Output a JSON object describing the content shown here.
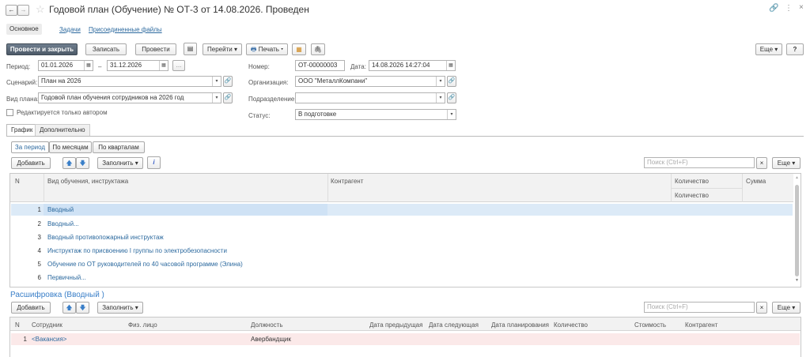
{
  "window": {
    "title": "Годовой план (Обучение) № ОТ-3 от 14.08.2026. Проведен",
    "more": "⋮",
    "close": "×"
  },
  "tabs": {
    "main": "Основное",
    "tasks": "Задачи",
    "files": "Присоединенные файлы"
  },
  "toolbar": {
    "post_close": "Провести и закрыть",
    "save": "Записать",
    "post": "Провести",
    "goto": "Перейти",
    "print": "Печать",
    "more": "Еще",
    "help": "?"
  },
  "form": {
    "period_label": "Период:",
    "period_from": "01.01.2026",
    "period_to": "31.12.2026",
    "dash": "–",
    "dots": "...",
    "scenario_label": "Сценарий:",
    "scenario": "План на 2026",
    "plan_type_label": "Вид плана:",
    "plan_type": "Годовой план обучения сотрудников на 2026 год",
    "author_only_label": "Редактируется только автором",
    "number_label": "Номер:",
    "number": "ОТ-00000003",
    "date_label": "Дата:",
    "date": "14.08.2026 14:27:04",
    "org_label": "Организация:",
    "org": "ООО \"МеталлКомпани\"",
    "dept_label": "Подразделение:",
    "dept": "",
    "status_label": "Статус:",
    "status": "В подготовке"
  },
  "inner_tabs": {
    "schedule": "График",
    "extra": "Дополнительно"
  },
  "period_switch": {
    "per_period": "За период",
    "by_month": "По месяцам",
    "by_quarter": "По кварталам"
  },
  "table1": {
    "add": "Добавить",
    "fill": "Заполнить",
    "search_placeholder": "Поиск (Ctrl+F)",
    "clear": "×",
    "more": "Еще",
    "headers": {
      "n": "N",
      "type": "Вид обучения, инструктажа",
      "counterparty": "Контрагент",
      "qty": "Количество",
      "qty2": "Количество",
      "sum": "Сумма"
    },
    "rows": [
      {
        "n": "1",
        "name": "Вводный"
      },
      {
        "n": "2",
        "name": "Вводный..."
      },
      {
        "n": "3",
        "name": "Вводный противопожарный инструктаж"
      },
      {
        "n": "4",
        "name": "Инструктаж по присвоению I группы по электробезопасности"
      },
      {
        "n": "5",
        "name": "Обучение по ОТ руководителей по 40 часовой программе (Элина)"
      },
      {
        "n": "6",
        "name": "Первичный..."
      }
    ]
  },
  "detail": {
    "title": "Расшифровка (Вводный )",
    "add": "Добавить",
    "fill": "Заполнить",
    "search_placeholder": "Поиск (Ctrl+F)",
    "clear": "×",
    "more": "Еще",
    "headers": {
      "n": "N",
      "employee": "Сотрудник",
      "person": "Физ. лицо",
      "position": "Должность",
      "prev_date": "Дата предыдущая",
      "next_date": "Дата следующая",
      "plan_date": "Дата планирования",
      "qty": "Количество",
      "cost": "Стоимость",
      "counterparty": "Контрагент"
    },
    "rows": [
      {
        "n": "1",
        "employee": "<Вакансия>",
        "person": "",
        "position": "Авербандщик"
      }
    ]
  },
  "colors": {
    "accent": "#2d6a9f",
    "selected_row": "#dceaf7",
    "selected_cell": "#cfe2f5",
    "detail_row": "#fbe9e9",
    "primary_button": "#5a6775"
  }
}
